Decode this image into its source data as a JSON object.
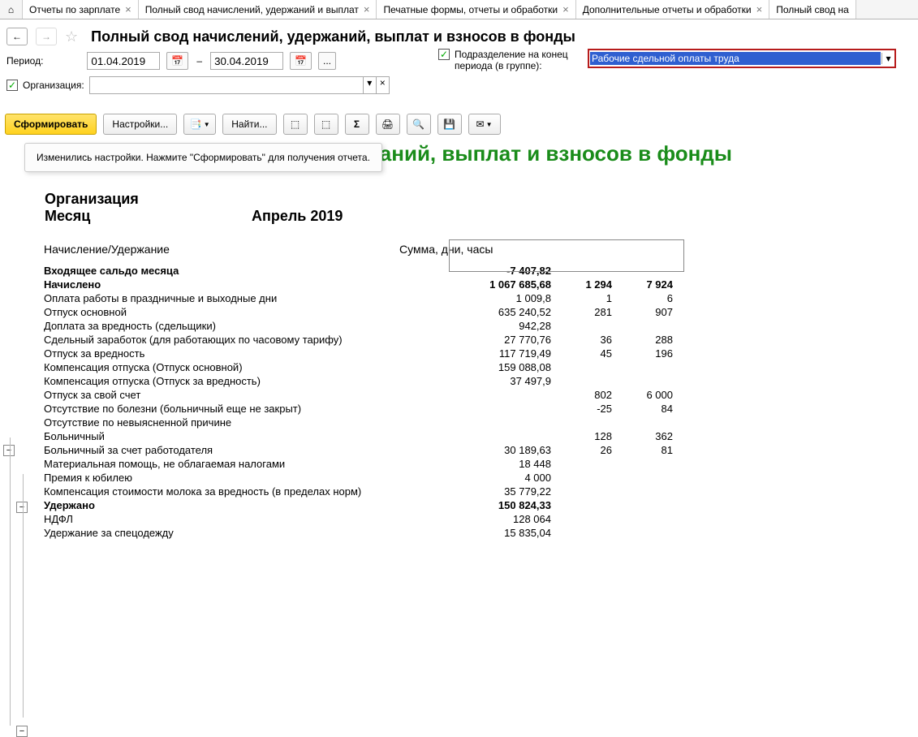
{
  "tabs": {
    "t1": "Отчеты по зарплате",
    "t2": "Полный свод начислений, удержаний и выплат",
    "t3": "Печатные формы, отчеты и обработки",
    "t4": "Дополнительные отчеты и обработки",
    "t5": "Полный свод на"
  },
  "page_title": "Полный свод начислений, удержаний, выплат и взносов в фонды",
  "labels": {
    "period": "Период:",
    "org": "Организация:",
    "subdiv": "Подразделение на конец периода (в группе):"
  },
  "dates": {
    "from": "01.04.2019",
    "to": "30.04.2019"
  },
  "subdiv_value": "Рабочие сдельной оплаты труда",
  "toolbar": {
    "generate": "Сформировать",
    "settings": "Настройки...",
    "find": "Найти..."
  },
  "hint": "Изменились настройки. Нажмите \"Сформировать\" для получения отчета.",
  "report_title_tail": "ержаний, выплат и взносов в фонды",
  "meta": {
    "org": "Организация",
    "month_label": "Месяц",
    "month_value": "Апрель 2019"
  },
  "cols": {
    "c1": "Начисление/Удержание",
    "c2": "Сумма, дни, часы"
  },
  "rows": [
    {
      "c1": "Входящее сальдо месяца",
      "c2": "-7 407,82",
      "b": true
    },
    {
      "c1": "Начислено",
      "c2": "1 067 685,68",
      "c3": "1 294",
      "c4": "7 924",
      "b": true
    },
    {
      "c1": "Оплата работы в праздничные и выходные дни",
      "c2": "1 009,8",
      "c3": "1",
      "c4": "6"
    },
    {
      "c1": "Отпуск основной",
      "c2": "635 240,52",
      "c3": "281",
      "c4": "907"
    },
    {
      "c1": "Доплата за вредность (сдельщики)",
      "c2": "942,28"
    },
    {
      "c1": "Сдельный заработок (для работающих по часовому тарифу)",
      "c2": "27 770,76",
      "c3": "36",
      "c4": "288"
    },
    {
      "c1": "Отпуск за вредность",
      "c2": "117 719,49",
      "c3": "45",
      "c4": "196"
    },
    {
      "c1": "Компенсация отпуска (Отпуск основной)",
      "c2": "159 088,08"
    },
    {
      "c1": "Компенсация отпуска (Отпуск за вредность)",
      "c2": "37 497,9"
    },
    {
      "c1": "Отпуск за свой счет",
      "c3": "802",
      "c4": "6 000"
    },
    {
      "c1": "Отсутствие по болезни (больничный еще не закрыт)",
      "c3": "-25",
      "c4": "84"
    },
    {
      "c1": "Отсутствие по невыясненной причине"
    },
    {
      "c1": "Больничный",
      "c3": "128",
      "c4": "362"
    },
    {
      "c1": "Больничный за счет работодателя",
      "c2": "30 189,63",
      "c3": "26",
      "c4": "81"
    },
    {
      "c1": "Материальная помощь, не облагаемая налогами",
      "c2": "18 448"
    },
    {
      "c1": "Премия к юбилею",
      "c2": "4 000"
    },
    {
      "c1": "Компенсация стоимости молока за вредность (в пределах норм)",
      "c2": "35 779,22"
    },
    {
      "c1": "Удержано",
      "c2": "150 824,33",
      "b": true
    },
    {
      "c1": "НДФЛ",
      "c2": "128 064"
    },
    {
      "c1": "Удержание за спецодежду",
      "c2": "15 835,04"
    }
  ]
}
